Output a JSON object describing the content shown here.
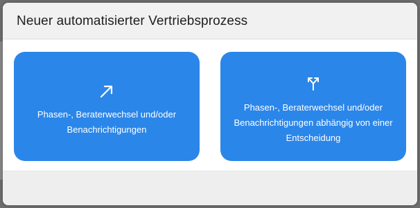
{
  "modal": {
    "title": "Neuer automatisierter Vertriebsprozess"
  },
  "options": [
    {
      "icon": "arrow-up-right-icon",
      "label": "Phasen-, Beraterwechsel und/oder Benachrichtigungen"
    },
    {
      "icon": "branch-split-icon",
      "label": "Phasen-, Beraterwechsel und/oder Benachrichtigungen abhängig von einer Entscheidung"
    }
  ],
  "colors": {
    "card": "#2b86e9",
    "modal_bg": "#f1f1f1",
    "body_bg": "#ffffff",
    "overlay": "#6f6f6f"
  }
}
